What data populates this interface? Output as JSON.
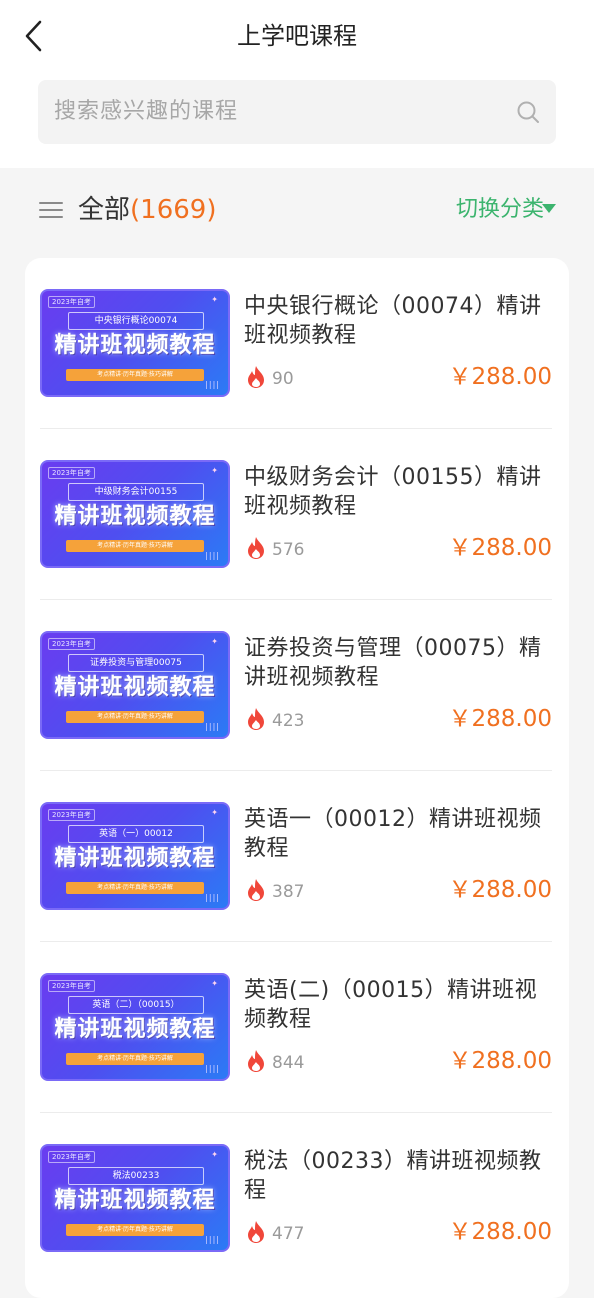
{
  "header": {
    "title": "上学吧课程"
  },
  "search": {
    "placeholder": "搜索感兴趣的课程"
  },
  "filter": {
    "all_label": "全部",
    "count": "1669",
    "switch_label": "切换分类"
  },
  "courses": [
    {
      "title": "中央银行概论（00074）精讲班视频教程",
      "views": "90",
      "price": "￥288.00",
      "thumb_subject": "中央银行概论00074",
      "thumb_text": "精讲班视频教程"
    },
    {
      "title": "中级财务会计（00155）精讲班视频教程",
      "views": "576",
      "price": "￥288.00",
      "thumb_subject": "中级财务会计00155",
      "thumb_text": "精讲班视频教程"
    },
    {
      "title": "证券投资与管理（00075）精讲班视频教程",
      "views": "423",
      "price": "￥288.00",
      "thumb_subject": "证券投资与管理00075",
      "thumb_text": "精讲班视频教程"
    },
    {
      "title": "英语一（00012）精讲班视频教程",
      "views": "387",
      "price": "￥288.00",
      "thumb_subject": "英语（一）00012",
      "thumb_text": "精讲班视频教程"
    },
    {
      "title": "英语(二)（00015）精讲班视频教程",
      "views": "844",
      "price": "￥288.00",
      "thumb_subject": "英语（二）（00015）",
      "thumb_text": "精讲班视频教程"
    },
    {
      "title": "税法（00233）精讲班视频教程",
      "views": "477",
      "price": "￥288.00",
      "thumb_subject": "税法00233",
      "thumb_text": "精讲班视频教程"
    }
  ],
  "colors": {
    "price": "#f07020",
    "accent_green": "#3cb46e",
    "count": "#f07020",
    "flame": "#f0473a"
  },
  "icons": {
    "back": "chevron-left-icon",
    "search": "search-icon",
    "menu": "menu-icon",
    "caret": "caret-down-icon",
    "views": "flame-icon"
  }
}
